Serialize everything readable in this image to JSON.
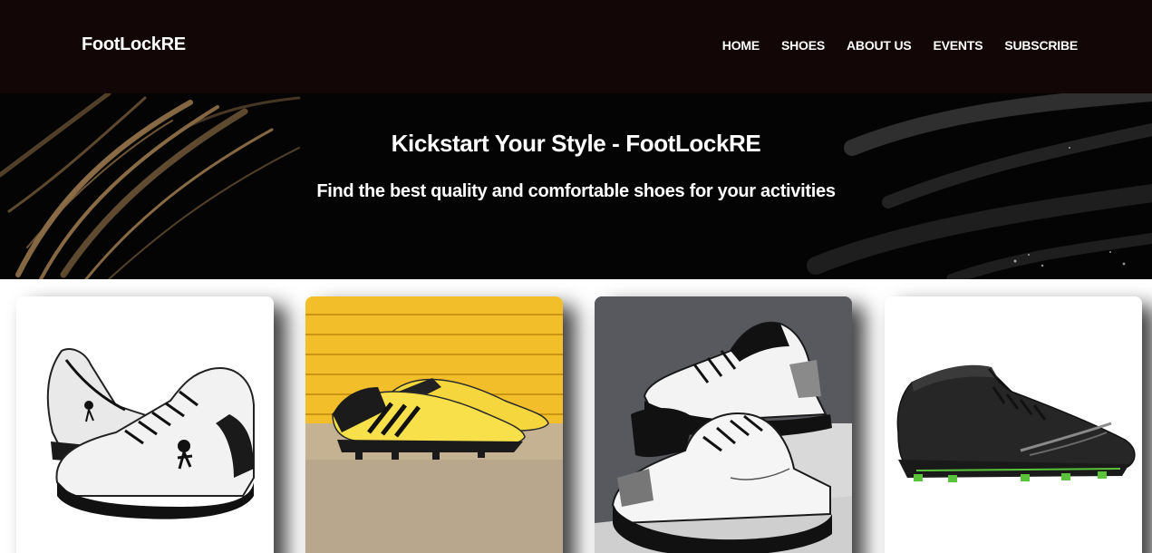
{
  "navbar": {
    "brand": "FootLockRE",
    "links": [
      "HOME",
      "SHOES",
      "ABOUT US",
      "EVENTS",
      "SUBSCRIBE"
    ]
  },
  "hero": {
    "title": "Kickstart Your Style - FootLockRE",
    "subtitle": "Find the best quality and comfortable shoes for your activities"
  },
  "products": [
    {
      "image": "white-black-basketball-sneakers"
    },
    {
      "image": "yellow-football-cleats"
    },
    {
      "image": "white-black-terde-sneakers"
    },
    {
      "image": "black-football-boot"
    }
  ],
  "colors": {
    "navbar_bg": "#130606",
    "hero_brush": "#b08a55",
    "card_bg": "#ffffff"
  }
}
